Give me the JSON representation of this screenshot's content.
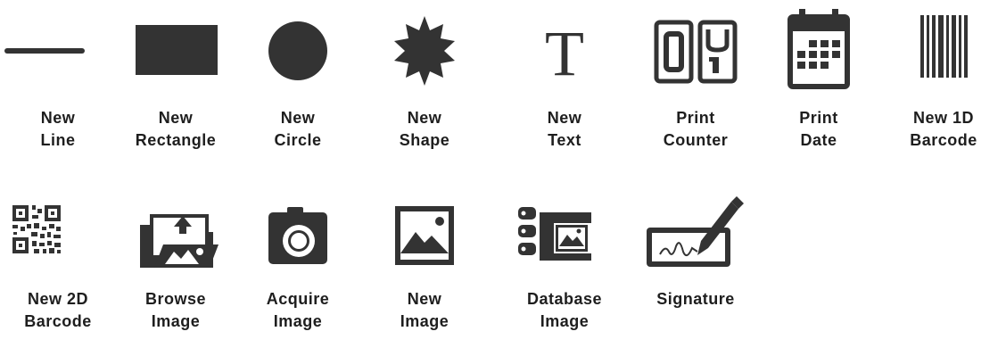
{
  "palette": {
    "icon_color": "#333333",
    "text_color": "#1e1e1e",
    "background": "#ffffff"
  },
  "tools": [
    {
      "id": "new-line",
      "icon": "line-icon",
      "line1": "New",
      "line2": "Line"
    },
    {
      "id": "new-rectangle",
      "icon": "rectangle-icon",
      "line1": "New",
      "line2": "Rectangle"
    },
    {
      "id": "new-circle",
      "icon": "circle-icon",
      "line1": "New",
      "line2": "Circle"
    },
    {
      "id": "new-shape",
      "icon": "star-shape-icon",
      "line1": "New",
      "line2": "Shape"
    },
    {
      "id": "new-text",
      "icon": "text-t-icon",
      "line1": "New",
      "line2": "Text"
    },
    {
      "id": "print-counter",
      "icon": "counter-icon",
      "line1": "Print",
      "line2": "Counter"
    },
    {
      "id": "print-date",
      "icon": "calendar-icon",
      "line1": "Print",
      "line2": "Date"
    },
    {
      "id": "new-1d-barcode",
      "icon": "barcode-icon",
      "line1": "New 1D",
      "line2": "Barcode"
    },
    {
      "id": "new-2d-barcode",
      "icon": "qr-code-icon",
      "line1": "New 2D",
      "line2": "Barcode"
    },
    {
      "id": "browse-image",
      "icon": "browse-image-icon",
      "line1": "Browse",
      "line2": "Image"
    },
    {
      "id": "acquire-image",
      "icon": "camera-icon",
      "line1": "Acquire",
      "line2": "Image"
    },
    {
      "id": "new-image",
      "icon": "picture-icon",
      "line1": "New",
      "line2": "Image"
    },
    {
      "id": "database-image",
      "icon": "database-image-icon",
      "line1": "Database",
      "line2": "Image"
    },
    {
      "id": "signature",
      "icon": "signature-icon",
      "line1": "Signature",
      "line2": ""
    }
  ]
}
